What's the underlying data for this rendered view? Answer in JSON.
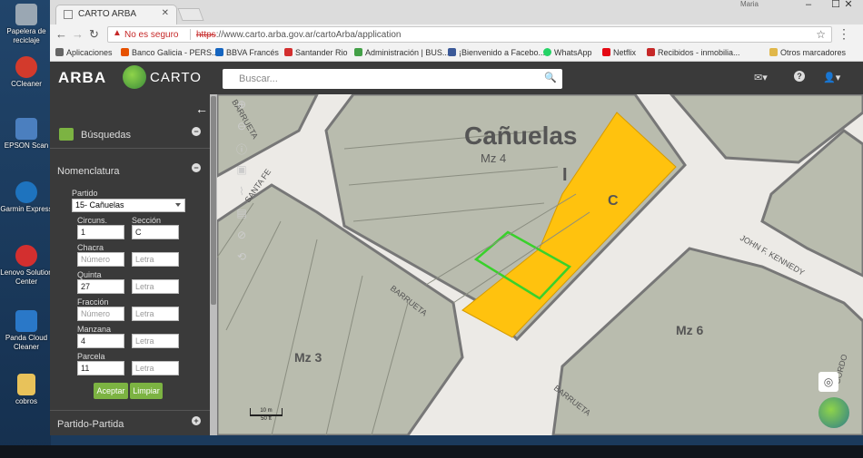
{
  "desktop": {
    "icons": [
      {
        "label": "Papelera de reciclaje",
        "icon": "recycle-bin-icon",
        "color": "#9aa7b3"
      },
      {
        "label": "CCleaner",
        "icon": "ccleaner-icon",
        "color": "#d33a2c"
      },
      {
        "label": "EPSON Scan",
        "icon": "epson-scan-icon",
        "color": "#4b7fbf"
      },
      {
        "label": "Garmin Express",
        "icon": "garmin-icon",
        "color": "#1e73be"
      },
      {
        "label": "Lenovo Solution Center",
        "icon": "lenovo-icon",
        "color": "#d32f2f"
      },
      {
        "label": "Panda Cloud Cleaner",
        "icon": "panda-icon",
        "color": "#2a78c8"
      },
      {
        "label": "cobros",
        "icon": "folder-icon",
        "color": "#e8c25a"
      }
    ]
  },
  "browser": {
    "tab_title": "CARTO ARBA",
    "window_user": "Maria",
    "address": {
      "warning": "No es seguro",
      "https": "https",
      "url_rest": "://www.carto.arba.gov.ar/cartoArba/application"
    },
    "bookmarks": [
      {
        "label": "Aplicaciones",
        "color": "#666"
      },
      {
        "label": "Banco Galicia - PERS...",
        "color": "#e65100"
      },
      {
        "label": "BBVA Francés",
        "color": "#1565c0"
      },
      {
        "label": "Santander Rio",
        "color": "#d32f2f"
      },
      {
        "label": "Administración | BUS...",
        "color": "#43a047"
      },
      {
        "label": "¡Bienvenido a Facebo...",
        "color": "#3b5998"
      },
      {
        "label": "WhatsApp",
        "color": "#25d366"
      },
      {
        "label": "Netflix",
        "color": "#e50914"
      },
      {
        "label": "Recibidos - inmobilia...",
        "color": "#c62828"
      },
      {
        "label": "Otros marcadores",
        "color": "#e0b74a"
      }
    ]
  },
  "app": {
    "logo_arba": "ARBA",
    "logo_carto": "CARTO",
    "search_placeholder": "Buscar...",
    "sidebar": {
      "busquedas": "Búsquedas",
      "nomenclatura": "Nomenclatura",
      "partido_label": "Partido",
      "partido_value": "15- Cañuelas",
      "circuns_label": "Circuns.",
      "circuns_value": "1",
      "seccion_label": "Sección",
      "seccion_value": "C",
      "chacra_label": "Chacra",
      "numero_ph": "Número",
      "letra_ph": "Letra",
      "quinta_label": "Quinta",
      "quinta_value": "27",
      "fraccion_label": "Fracción",
      "manzana_label": "Manzana",
      "manzana_value": "4",
      "parcela_label": "Parcela",
      "parcela_value": "11",
      "aceptar": "Aceptar",
      "limpiar": "Limpiar",
      "partido_partida": "Partido-Partida"
    },
    "map": {
      "city": "Cañuelas",
      "mz4": "Mz 4",
      "mz3": "Mz 3",
      "mz6": "Mz 6",
      "circ": "I",
      "sec": "C",
      "street_barrueta": "BARRUETA",
      "street_santafe": "SANTA FE",
      "street_kennedy": "JOHN F. KENNEDY",
      "street_cordoba": "CORDO",
      "scale_m": "10 m",
      "scale_ft": "50 ft",
      "highlight_color": "#ffc20e",
      "selected_color": "#39d12b"
    }
  }
}
